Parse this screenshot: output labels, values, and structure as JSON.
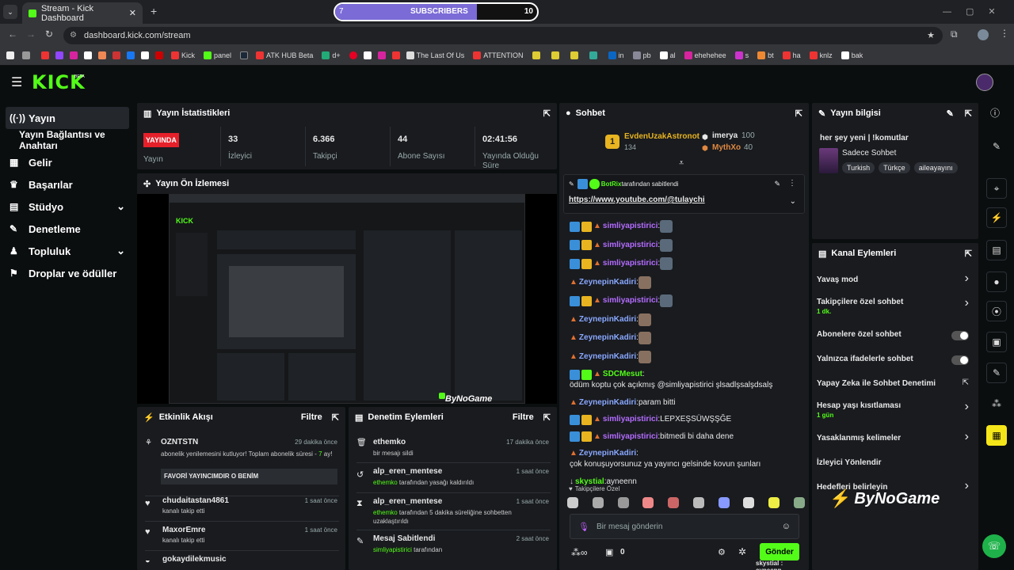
{
  "browser": {
    "tab_title": "Stream - Kick Dashboard",
    "url": "dashboard.kick.com/stream",
    "bookmarks": [
      "Kick",
      "panel",
      "ATK HUB Beta",
      "d+",
      "The Last Of Us",
      "ATTENTION",
      "in",
      "pb",
      "al",
      "ehehehee",
      "s",
      "bt",
      "ha",
      "knlz",
      "bak"
    ]
  },
  "sub_goal": {
    "current": "7",
    "label": "SUBSCRIBERS",
    "target": "10",
    "fill_fraction": 0.7
  },
  "app": {
    "logo": "KICK",
    "logo_sup": "BETA"
  },
  "sidebar": {
    "items": [
      {
        "label": "Yayın",
        "icon": "broadcast-icon"
      },
      {
        "label": "Yayın Bağlantısı ve Anahtarı",
        "icon": ""
      },
      {
        "label": "Gelir",
        "icon": "revenue-icon"
      },
      {
        "label": "Başarılar",
        "icon": "trophy-icon"
      },
      {
        "label": "Stüdyo",
        "icon": "studio-icon"
      },
      {
        "label": "Denetleme",
        "icon": "wrench-icon"
      },
      {
        "label": "Topluluk",
        "icon": "community-icon"
      },
      {
        "label": "Droplar ve ödüller",
        "icon": "gift-icon"
      }
    ]
  },
  "stats": {
    "title": "Yayın İstatistikleri",
    "live_badge": "YAYINDA",
    "items": [
      {
        "value": "",
        "label": "Yayın"
      },
      {
        "value": "33",
        "label": "İzleyici"
      },
      {
        "value": "6.366",
        "label": "Takipçi"
      },
      {
        "value": "44",
        "label": "Abone Sayısı"
      },
      {
        "value": "02:41:56",
        "label": "Yayında Olduğu Süre"
      }
    ]
  },
  "preview": {
    "title": "Yayın Ön İzlemesi",
    "watermark": "ByNoGame"
  },
  "activity": {
    "title": "Etkinlik Akışı",
    "filter": "Filtre",
    "items": [
      {
        "user": "OZNTSTN",
        "time": "29 dakika önce",
        "text": "abonelik yenilemesini kutluyor! Toplam abonelik süresi - ",
        "highlight": "7",
        "text2": " ay!",
        "message": "FAVORİ YAYINCIMDIR O BENİM"
      },
      {
        "user": "chudaitastan4861",
        "time": "1 saat önce",
        "text": "kanalı takip etti"
      },
      {
        "user": "MaxorEmre",
        "time": "1 saat önce",
        "text": "kanalı takip etti"
      },
      {
        "user": "gokaydilekmusic",
        "time": "",
        "text": ""
      }
    ]
  },
  "mod_actions": {
    "title": "Denetim Eylemleri",
    "filter": "Filtre",
    "items": [
      {
        "user": "ethemko",
        "time": "17 dakika önce",
        "actor": "",
        "text": "bir mesajı sildi"
      },
      {
        "user": "alp_eren_mentese",
        "time": "1 saat önce",
        "actor": "ethemko",
        "text": " tarafından yasağı kaldırıldı"
      },
      {
        "user": "alp_eren_mentese",
        "time": "1 saat önce",
        "actor": "ethemko",
        "text": " tarafından 5 dakika süreliğine sohbetten uzaklaştırıldı"
      },
      {
        "user": "Mesaj Sabitlendi",
        "time": "2 saat önce",
        "actor": "simliyapistirici",
        "text": " tarafından"
      }
    ]
  },
  "chat": {
    "title": "Sohbet",
    "top_gifters": [
      {
        "name": "EvdenUzakAstronot",
        "count": "134"
      },
      {
        "name": "imerya",
        "count": "100"
      },
      {
        "name": "MythXo",
        "count": "40"
      }
    ],
    "pinned_by": "BotRix",
    "pinned_suffix": " tarafından sabitlendi",
    "pinned_link": "https://www.youtube.com/@tulaychi",
    "messages": [
      {
        "user": "simliyapistirici",
        "color": "#b46cff",
        "text": ""
      },
      {
        "user": "simliyapistirici",
        "color": "#b46cff",
        "text": ""
      },
      {
        "user": "simliyapistirici",
        "color": "#b46cff",
        "text": ""
      },
      {
        "user": "ZeynepinKadiri",
        "color": "#8aa8ff",
        "text": ""
      },
      {
        "user": "simliyapistirici",
        "color": "#b46cff",
        "text": ""
      },
      {
        "user": "ZeynepinKadiri",
        "color": "#8aa8ff",
        "text": ""
      },
      {
        "user": "ZeynepinKadiri",
        "color": "#8aa8ff",
        "text": ""
      },
      {
        "user": "ZeynepinKadiri",
        "color": "#8aa8ff",
        "text": ""
      },
      {
        "user": "SDCMesut",
        "color": "#53fc18",
        "text": "ödüm koptu çok açıkmış @simliyapistirici şlsadlşsalşdsalş"
      },
      {
        "user": "ZeynepinKadiri",
        "color": "#8aa8ff",
        "text": "param bitti"
      },
      {
        "user": "simliyapistirici",
        "color": "#b46cff",
        "text": "LEPXEŞSÜWŞŞĞE"
      },
      {
        "user": "simliyapistirici",
        "color": "#b46cff",
        "text": "bitmedi bi daha dene"
      },
      {
        "user": "ZeynepinKadiri",
        "color": "#8aa8ff",
        "text": "çok konuşuyorsunuz ya yayıncı gelsinde kovun şunları"
      },
      {
        "user": "skystial",
        "color": "#53fc18",
        "text": "ayneenn"
      }
    ],
    "followers_only": "Takipçilere Özel",
    "input_placeholder": "Bir mesaj gönderin",
    "send": "Gönder",
    "points": "0",
    "bottom_reply": "skystial : ayneenn"
  },
  "stream_info": {
    "title": "Yayın bilgisi",
    "stream_title": "her şey yeni | !komutlar",
    "category": "Sadece Sohbet",
    "tags": [
      "Turkish",
      "Türkçe",
      "aileayayını"
    ]
  },
  "channel_actions": {
    "title": "Kanal Eylemleri",
    "items": [
      {
        "label": "Yavaş mod",
        "sub": "",
        "control": "chevron"
      },
      {
        "label": "Takipçilere özel sohbet",
        "sub": "1 dk.",
        "control": "chevron"
      },
      {
        "label": "Abonelere özel sohbet",
        "sub": "",
        "control": "toggle"
      },
      {
        "label": "Yalnızca ifadelerle sohbet",
        "sub": "",
        "control": "toggle"
      },
      {
        "label": "Yapay Zeka ile Sohbet Denetimi",
        "sub": "",
        "control": "external"
      },
      {
        "label": "Hesap yaşı kısıtlaması",
        "sub": "1 gün",
        "control": "chevron"
      },
      {
        "label": "Yasaklanmış kelimeler",
        "sub": "",
        "control": "chevron"
      },
      {
        "label": "İzleyici Yönlendir",
        "sub": "",
        "control": "none"
      },
      {
        "label": "Hedefleri belirleyin",
        "sub": "",
        "control": "chevron"
      }
    ],
    "brand": "ByNoGame"
  },
  "colors": {
    "accent": "#53fc18",
    "panel": "#191b1f",
    "live": "#e5202a",
    "sub_fill": "#7b6bd6"
  }
}
